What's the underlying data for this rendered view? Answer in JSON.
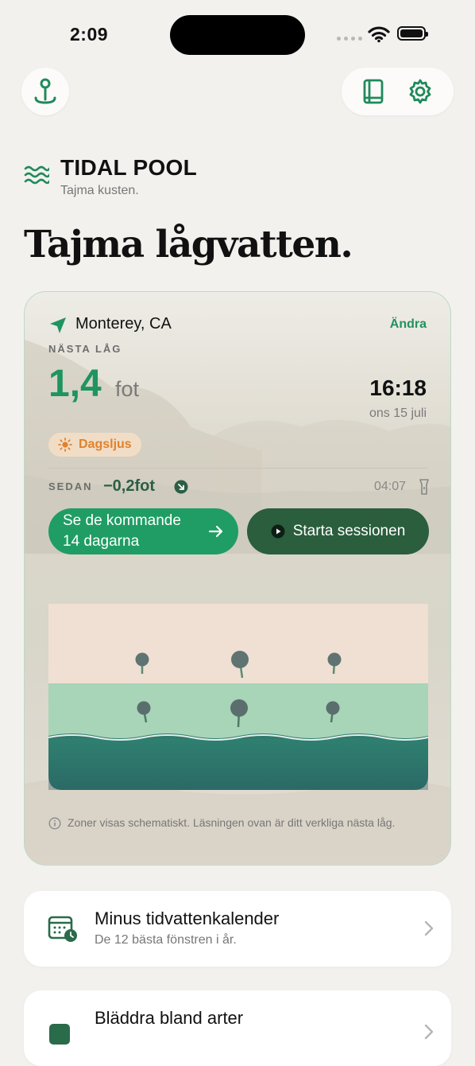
{
  "status_bar": {
    "time": "2:09"
  },
  "brand": {
    "title": "TIDAL POOL",
    "subtitle": "Tajma kusten."
  },
  "headline": "Tajma lågvatten.",
  "card": {
    "location": "Monterey, CA",
    "change_label": "Ändra",
    "next_low_label": "NÄSTA LÅG",
    "next_low_value": "1,4",
    "next_low_unit": "fot",
    "next_low_time": "16:18",
    "next_low_date": "ons 15 juli",
    "daylight_chip": "Dagsljus",
    "since_label": "SEDAN",
    "since_value": "−0,2fot",
    "since_time": "04:07",
    "see_days_button_line1": "Se de kommande",
    "see_days_button_line2": "14 dagarna",
    "start_session_button": "Starta sessionen",
    "note": "Zoner visas schematiskt. Läsningen ovan är ditt verkliga nästa låg."
  },
  "list": [
    {
      "title": "Minus tidvattenkalender",
      "subtitle": "De 12 bästa fönstren i år."
    },
    {
      "title": "Bläddra bland arter",
      "subtitle": ""
    }
  ],
  "colors": {
    "accent": "#1f9d64",
    "dark_accent": "#2a5e3d",
    "daylight": "#e0822c"
  },
  "icons": [
    "map-pin-icon",
    "book-icon",
    "gear-icon",
    "waves-icon",
    "navigation-arrow-icon",
    "sun-icon",
    "arrow-down-right-icon",
    "flashlight-icon",
    "arrow-right-icon",
    "play-icon",
    "info-icon",
    "calendar-icon",
    "chevron-right-icon"
  ]
}
